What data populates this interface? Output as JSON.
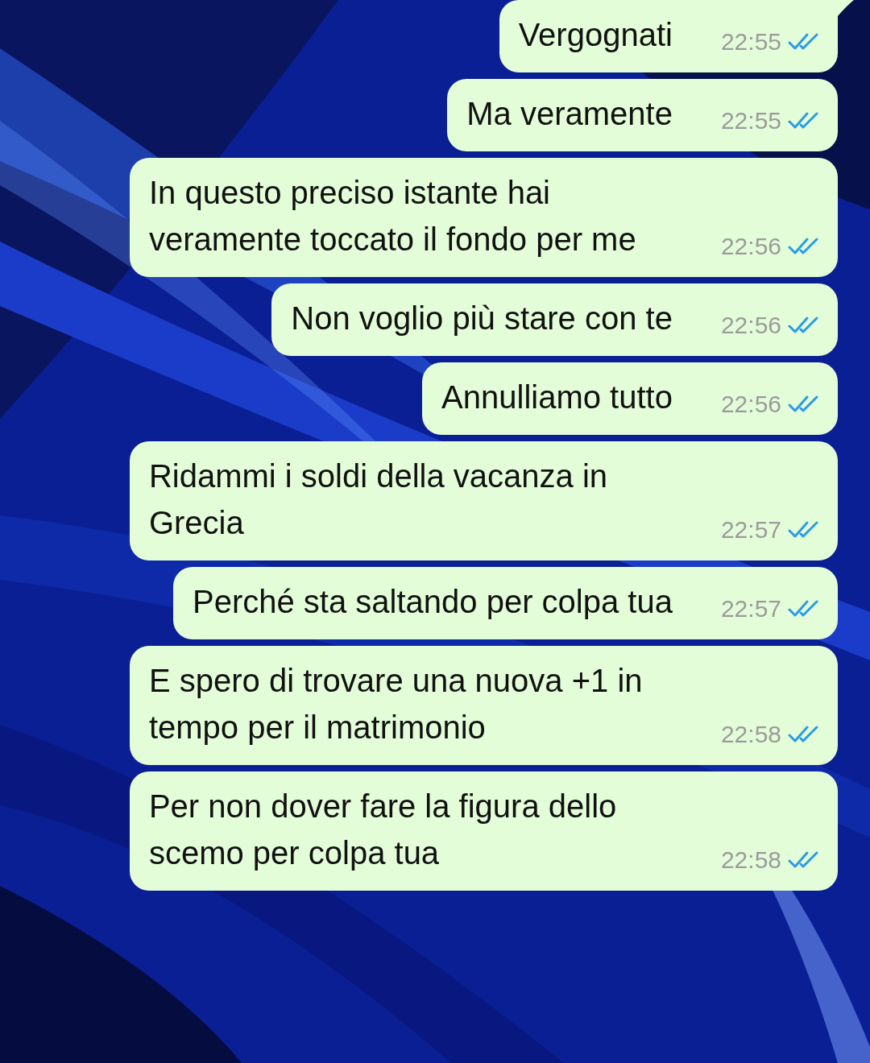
{
  "messages": [
    {
      "text": "Vergognati",
      "time": "22:55",
      "read": true
    },
    {
      "text": "Ma veramente",
      "time": "22:55",
      "read": true
    },
    {
      "text": "In questo preciso istante hai veramente toccato il fondo per me",
      "time": "22:56",
      "read": true
    },
    {
      "text": "Non voglio più stare con te",
      "time": "22:56",
      "read": true
    },
    {
      "text": "Annulliamo tutto",
      "time": "22:56",
      "read": true
    },
    {
      "text": "Ridammi i soldi della vacanza in Grecia",
      "time": "22:57",
      "read": true
    },
    {
      "text": "Perché sta saltando per colpa tua",
      "time": "22:57",
      "read": true
    },
    {
      "text": "E spero di trovare una nuova +1 in tempo per il matrimonio",
      "time": "22:58",
      "read": true
    },
    {
      "text": "Per non dover fare la figura dello scemo per colpa tua",
      "time": "22:58",
      "read": true
    }
  ]
}
